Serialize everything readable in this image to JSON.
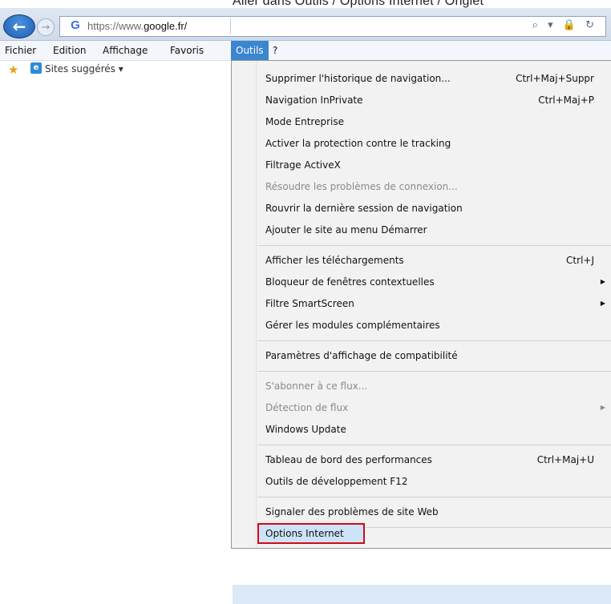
{
  "caption": "Aller dans Outils / Options Internet / Onglet",
  "browser": {
    "url_prefix": "https://www.",
    "url_domain": "google.fr/",
    "favicon": "G",
    "address_icons": "⌕ ▾ 🔒 ↻"
  },
  "menubar": {
    "items": [
      "Fichier",
      "Edition",
      "Affichage",
      "Favoris",
      "Outils",
      "?"
    ]
  },
  "favorites_bar": {
    "label": "Sites suggérés ▾"
  },
  "tools_menu": {
    "items": [
      {
        "label": "Supprimer l'historique de navigation...",
        "shortcut": "Ctrl+Maj+Suppr"
      },
      {
        "label": "Navigation InPrivate",
        "shortcut": "Ctrl+Maj+P"
      },
      {
        "label": "Mode Entreprise"
      },
      {
        "label": "Activer la protection contre le tracking"
      },
      {
        "label": "Filtrage ActiveX"
      },
      {
        "label": "Résoudre les problèmes de connexion...",
        "disabled": true
      },
      {
        "label": "Rouvrir la dernière session de navigation"
      },
      {
        "label": "Ajouter le site au menu Démarrer"
      },
      {
        "label": "Afficher les téléchargements",
        "shortcut": "Ctrl+J"
      },
      {
        "label": "Bloqueur de fenêtres contextuelles",
        "submenu": true
      },
      {
        "label": "Filtre SmartScreen",
        "submenu": true
      },
      {
        "label": "Gérer les modules complémentaires"
      },
      {
        "label": "Paramètres d'affichage de compatibilité"
      },
      {
        "label": "S'abonner à ce flux...",
        "disabled": true
      },
      {
        "label": "Détection de flux",
        "disabled": true,
        "submenu": true
      },
      {
        "label": "Windows Update"
      },
      {
        "label": "Tableau de bord des performances",
        "shortcut": "Ctrl+Maj+U"
      },
      {
        "label": "Outils de développement F12"
      },
      {
        "label": "Signaler des problèmes de site Web"
      },
      {
        "label": "Options Internet",
        "highlighted": true
      }
    ]
  },
  "colors": {
    "highlight_border": "#d20b14",
    "menu_active": "#3a86cf"
  }
}
